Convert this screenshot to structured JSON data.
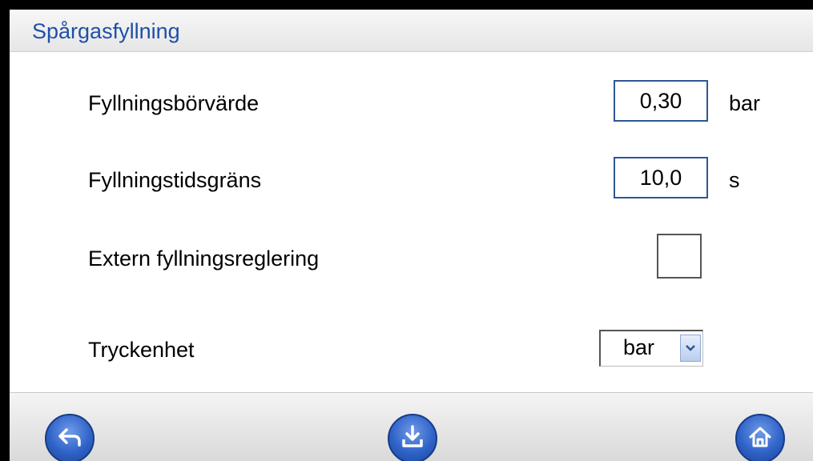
{
  "title": "Spårgasfyllning",
  "rows": [
    {
      "label": "Fyllningsbörvärde",
      "value": "0,30",
      "unit": "bar"
    },
    {
      "label": "Fyllningstidsgräns",
      "value": "10,0",
      "unit": "s"
    },
    {
      "label": "Extern fyllningsreglering",
      "checked": false
    },
    {
      "label": "Tryckenhet",
      "selected": "bar"
    }
  ],
  "icons": {
    "back": "back-arrow-icon",
    "save": "download-save-icon",
    "home": "home-icon",
    "dropdown": "chevron-down-icon"
  },
  "colors": {
    "title_text": "#1f4fa8",
    "button_blue": "#2f63c8",
    "input_border": "#2f5597"
  }
}
